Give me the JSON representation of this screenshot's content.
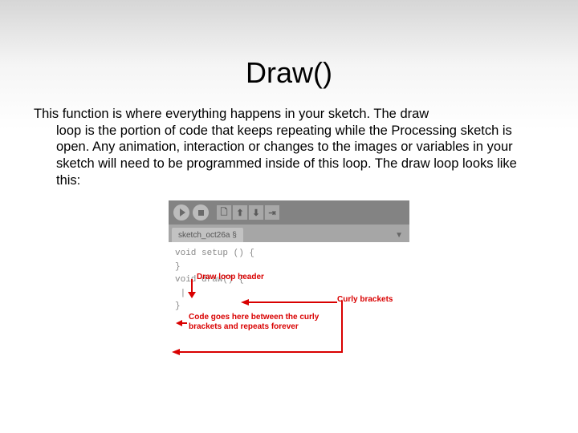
{
  "title": "Draw()",
  "body_first": "This function is where everything happens in your sketch. The draw",
  "body_rest": "loop is the portion of code that keeps repeating while the Processing sketch is open. Any animation, interaction or changes to the images or variables in your sketch will need to be programmed inside of this loop.  The draw loop looks like this:",
  "ide": {
    "tab_name": "sketch_oct26a §",
    "code_lines": {
      "l1": "void setup () {",
      "l2": "",
      "l3": "}",
      "l4": "",
      "l5": "void draw() {",
      "l6": "",
      "l7": " |",
      "l8": "",
      "l9": "}"
    },
    "icons": {
      "new": "🗋",
      "open": "⬆",
      "save": "⬇",
      "export": "⇥"
    }
  },
  "annotations": {
    "draw_header": "Draw loop header",
    "curly": "Curly brackets",
    "code_goes": "Code goes here between the curly brackets and repeats forever"
  }
}
